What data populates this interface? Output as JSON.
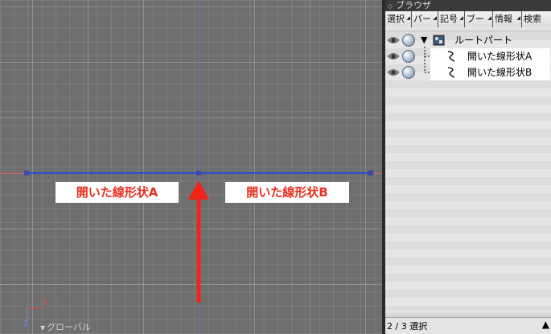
{
  "viewport": {
    "shape_label_a": "開いた線形状A",
    "shape_label_b": "開いた線形状B",
    "coordinate_system": "グローバル",
    "axis_x": "X",
    "axis_z": "Z",
    "colors": {
      "background": "#6e6e6e",
      "shape_line": "#2c4fc9",
      "red_axis": "#e44b4b",
      "blue_axis": "#4a63c8",
      "arrow": "#f0251a",
      "label_text": "#e8301e"
    }
  },
  "browser": {
    "title": "ブラウザ",
    "tabs": [
      {
        "label": "選択",
        "has_dropdown": true
      },
      {
        "label": "パー",
        "has_dropdown": true
      },
      {
        "label": "記号",
        "has_dropdown": true
      },
      {
        "label": "ブー",
        "has_dropdown": true
      },
      {
        "label": "情報",
        "has_dropdown": true
      },
      {
        "label": "検索",
        "has_dropdown": false
      }
    ],
    "tree": {
      "root": {
        "label": "ルートパート",
        "expanded": true,
        "icon": "part-icon"
      },
      "children": [
        {
          "label": "開いた線形状A",
          "icon": "open-line-shape-icon",
          "selected": true
        },
        {
          "label": "開いた線形状B",
          "icon": "open-line-shape-icon",
          "selected": true
        }
      ]
    },
    "status": "2 / 3 選択",
    "status_icon": "triangle-up-icon"
  }
}
